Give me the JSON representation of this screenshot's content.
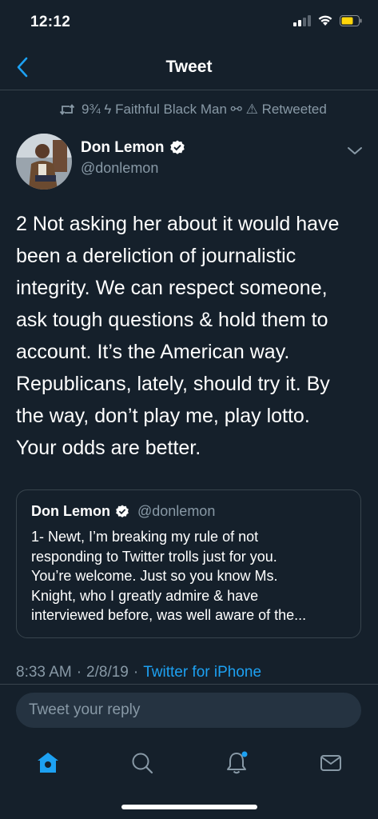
{
  "status_bar": {
    "time": "12:12"
  },
  "nav": {
    "title": "Tweet"
  },
  "retweet": {
    "text": "9¾ ϟ Faithful Black Man ⚯ ⚠ Retweeted"
  },
  "author": {
    "name": "Don Lemon",
    "handle": "@donlemon"
  },
  "tweet": {
    "lines": [
      "2 Not asking her about it would have",
      "been a dereliction of journalistic",
      "integrity. We can respect someone,",
      "ask tough questions & hold them to",
      "account. It’s the American way.",
      "Republicans, lately, should try it. By",
      "the way, don’t play me, play lotto.",
      "Your odds are better."
    ]
  },
  "quote": {
    "name": "Don Lemon",
    "handle": "@donlemon",
    "lines": [
      "1- Newt, I’m breaking my rule of not",
      "responding to Twitter trolls just for you.",
      "You’re welcome. Just so you know Ms.",
      "Knight, who I greatly admire & have",
      "interviewed before, was well aware of the..."
    ]
  },
  "meta": {
    "time": "8:33 AM",
    "separator1": "·",
    "date": "2/8/19",
    "separator2": "·",
    "source": "Twitter for iPhone"
  },
  "reply": {
    "placeholder": "Tweet your reply"
  },
  "tabs": [
    "home-icon",
    "search-icon",
    "notifications-icon",
    "messages-icon"
  ],
  "colors": {
    "background": "#15202b",
    "accent": "#1da1f2",
    "secondary_text": "#8899a6",
    "border": "#38444d"
  }
}
